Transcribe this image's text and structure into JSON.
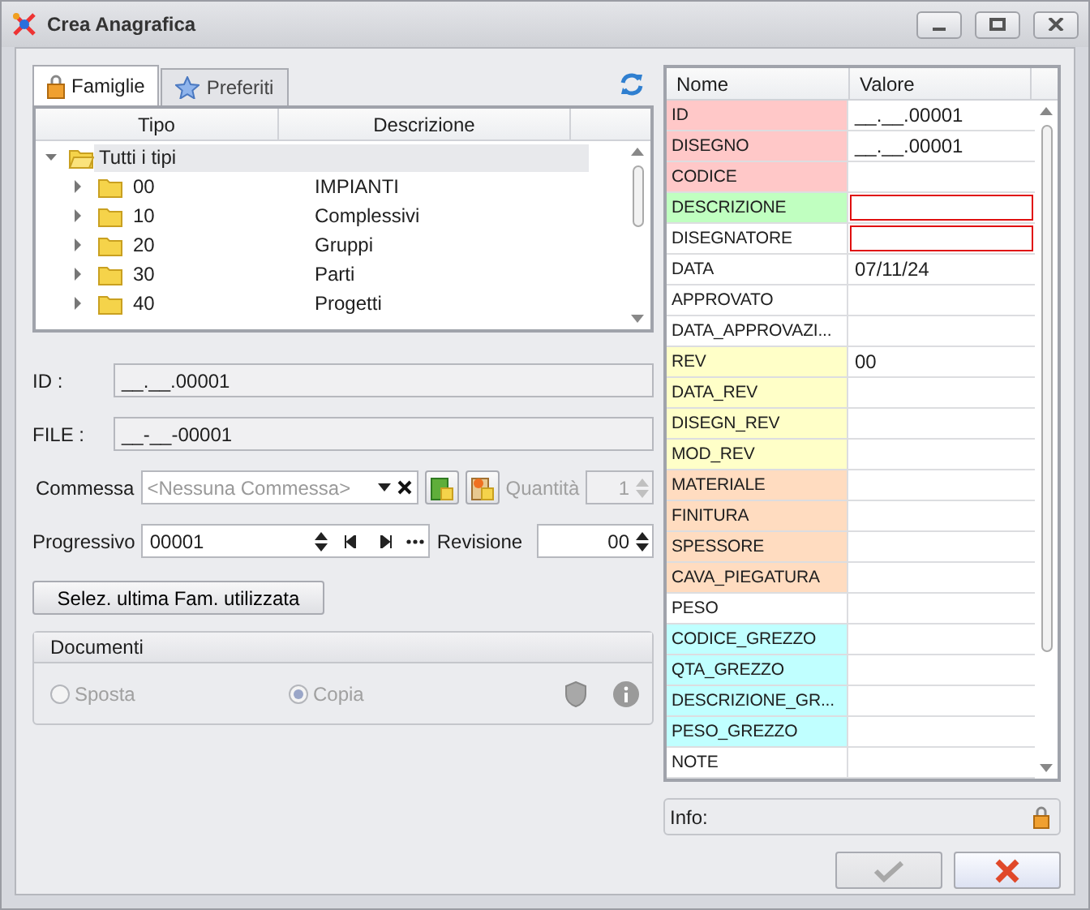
{
  "window": {
    "title": "Crea Anagrafica"
  },
  "tabs": [
    {
      "label": "Famiglie",
      "selected": true
    },
    {
      "label": "Preferiti",
      "selected": false
    }
  ],
  "tree": {
    "columns": [
      "Tipo",
      "Descrizione"
    ],
    "root": {
      "label": "Tutti i tipi",
      "expanded": true,
      "selected": true,
      "children": [
        {
          "code": "00",
          "description": "IMPIANTI",
          "expanded": false
        },
        {
          "code": "10",
          "description": "Complessivi",
          "expanded": false
        },
        {
          "code": "20",
          "description": "Gruppi",
          "expanded": false
        },
        {
          "code": "30",
          "description": "Parti",
          "expanded": false
        },
        {
          "code": "40",
          "description": "Progetti",
          "expanded": false
        }
      ]
    }
  },
  "id_field": {
    "label": "ID :",
    "value": "__.__.00001"
  },
  "file_field": {
    "label": "FILE :",
    "value": "__-__-00001"
  },
  "commessa": {
    "label": "Commessa",
    "placeholder": "<Nessuna Commessa>",
    "quantity_label": "Quantità",
    "quantity": "1",
    "quantity_disabled": true
  },
  "progressivo": {
    "label": "Progressivo",
    "value": "00001",
    "revision_label": "Revisione",
    "revision": "00"
  },
  "last_family_button": "Selez. ultima Fam. utilizzata",
  "documenti": {
    "title": "Documenti",
    "options": [
      {
        "label": "Sposta",
        "selected": false,
        "disabled": true
      },
      {
        "label": "Copia",
        "selected": true,
        "disabled": true
      }
    ]
  },
  "properties": {
    "columns": [
      "Nome",
      "Valore"
    ],
    "rows": [
      {
        "name": "ID",
        "value": "__.__.00001",
        "color": "#ffc8c8",
        "invalid": false
      },
      {
        "name": "DISEGNO",
        "value": "__.__.00001",
        "color": "#ffc8c8",
        "invalid": false
      },
      {
        "name": "CODICE",
        "color": "#ffc8c8",
        "invalid": false
      },
      {
        "name": "DESCRIZIONE",
        "color": "#c0ffc0",
        "invalid": true
      },
      {
        "name": "DISEGNATORE",
        "color": "#ffffff",
        "invalid": true
      },
      {
        "name": "DATA",
        "value": "07/11/24",
        "color": "#ffffff",
        "invalid": false
      },
      {
        "name": "APPROVATO",
        "color": "#ffffff",
        "invalid": false
      },
      {
        "name": "DATA_APPROVAZI...",
        "color": "#ffffff",
        "invalid": false
      },
      {
        "name": "REV",
        "value": "00",
        "color": "#ffffc8",
        "invalid": false
      },
      {
        "name": "DATA_REV",
        "color": "#ffffc8",
        "invalid": false
      },
      {
        "name": "DISEGN_REV",
        "color": "#ffffc8",
        "invalid": false
      },
      {
        "name": "MOD_REV",
        "color": "#ffffc8",
        "invalid": false
      },
      {
        "name": "MATERIALE",
        "color": "#ffdcc0",
        "invalid": false
      },
      {
        "name": "FINITURA",
        "color": "#ffdcc0",
        "invalid": false
      },
      {
        "name": "SPESSORE",
        "color": "#ffdcc0",
        "invalid": false
      },
      {
        "name": "CAVA_PIEGATURA",
        "color": "#ffdcc0",
        "invalid": false
      },
      {
        "name": "PESO",
        "color": "#ffffff",
        "invalid": false
      },
      {
        "name": "CODICE_GREZZO",
        "color": "#c0ffff",
        "invalid": false
      },
      {
        "name": "QTA_GREZZO",
        "color": "#c0ffff",
        "invalid": false
      },
      {
        "name": "DESCRIZIONE_GR...",
        "color": "#c0ffff",
        "invalid": false
      },
      {
        "name": "PESO_GREZZO",
        "color": "#c0ffff",
        "invalid": false
      },
      {
        "name": "NOTE",
        "color": "#ffffff",
        "invalid": false
      }
    ]
  },
  "info": {
    "label": "Info:"
  },
  "buttons": [
    {
      "kind": "ok",
      "disabled": true
    },
    {
      "kind": "cancel",
      "disabled": false
    }
  ]
}
